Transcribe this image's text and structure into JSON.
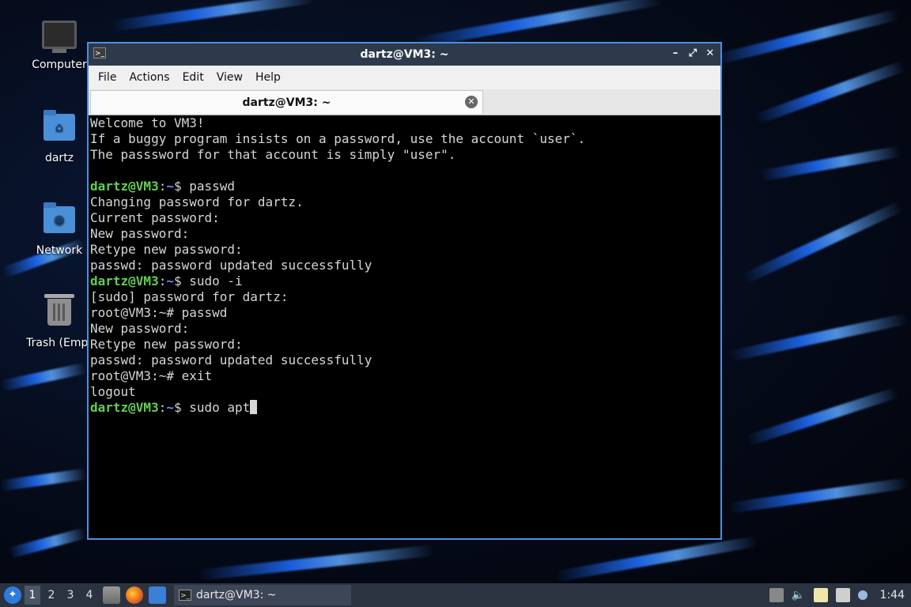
{
  "desktop": {
    "icons": [
      {
        "label": "Computer",
        "icon": "computer-icon"
      },
      {
        "label": "dartz",
        "icon": "home-folder-icon"
      },
      {
        "label": "Network",
        "icon": "network-folder-icon"
      },
      {
        "label": "Trash (Empt",
        "icon": "trash-icon"
      }
    ]
  },
  "window": {
    "title": "dartz@VM3: ~",
    "menu": [
      "File",
      "Actions",
      "Edit",
      "View",
      "Help"
    ],
    "tab_label": "dartz@VM3: ~",
    "controls": [
      "minimize",
      "maximize",
      "close"
    ]
  },
  "terminal": {
    "lines": [
      {
        "text": "Welcome to VM3!"
      },
      {
        "text": "If a buggy program insists on a password, use the account `user`."
      },
      {
        "text": "The passsword for that account is simply \"user\"."
      },
      {
        "text": ""
      },
      {
        "user": "dartz@VM3",
        "path": "~",
        "sym": "$ ",
        "cmd": "passwd"
      },
      {
        "text": "Changing password for dartz."
      },
      {
        "text": "Current password:"
      },
      {
        "text": "New password:"
      },
      {
        "text": "Retype new password:"
      },
      {
        "text": "passwd: password updated successfully"
      },
      {
        "user": "dartz@VM3",
        "path": "~",
        "sym": "$ ",
        "cmd": "sudo -i"
      },
      {
        "text": "[sudo] password for dartz:"
      },
      {
        "text": "root@VM3:~# passwd"
      },
      {
        "text": "New password:"
      },
      {
        "text": "Retype new password:"
      },
      {
        "text": "passwd: password updated successfully"
      },
      {
        "text": "root@VM3:~# exit"
      },
      {
        "text": "logout"
      },
      {
        "user": "dartz@VM3",
        "path": "~",
        "sym": "$ ",
        "cmd": "sudo apt",
        "cursor": true
      }
    ]
  },
  "taskbar": {
    "workspaces": [
      "1",
      "2",
      "3",
      "4"
    ],
    "active_workspace": "1",
    "task_label": "dartz@VM3: ~",
    "clock": "1:44",
    "tray_icons": [
      "notes-icon",
      "volume-icon",
      "clipboard-icon",
      "network-icon"
    ]
  },
  "colors": {
    "prompt_user": "#60d050",
    "prompt_path": "#6b8cff",
    "window_border": "#4d8fe0"
  }
}
